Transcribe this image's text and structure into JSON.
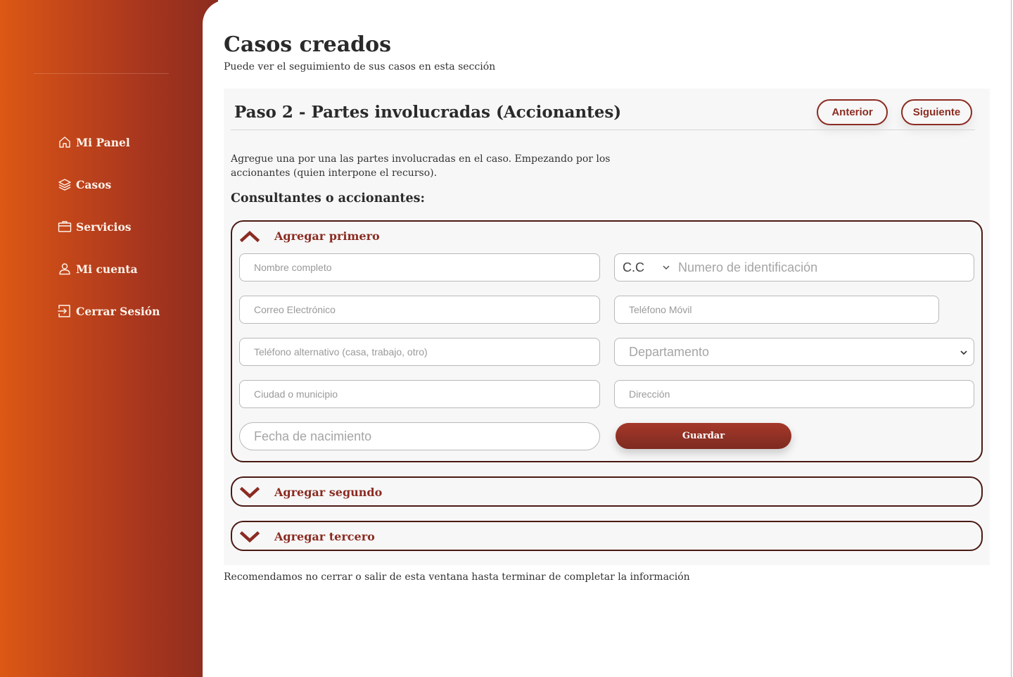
{
  "nav": [
    {
      "label": "Mi Panel",
      "icon": "home-icon"
    },
    {
      "label": "Casos",
      "icon": "layers-icon"
    },
    {
      "label": "Servicios",
      "icon": "briefcase-icon"
    },
    {
      "label": "Mi cuenta",
      "icon": "user-icon"
    },
    {
      "label": "Cerrar Sesión",
      "icon": "logout-icon"
    }
  ],
  "page": {
    "title": "Casos creados",
    "subtitle": "Puede ver el seguimiento de sus casos en esta sección"
  },
  "step": {
    "title": "Paso 2 - Partes involucradas (Accionantes)",
    "prev_label": "Anterior",
    "next_label": "Siguiente",
    "intro": "Agregue una por una las partes involucradas en el caso. Empezando por los accionantes (quien interpone el recurso).",
    "section_label": "Consultantes o accionantes:"
  },
  "accordions": [
    {
      "label": "Agregar primero",
      "expanded": true
    },
    {
      "label": "Agregar segundo",
      "expanded": false
    },
    {
      "label": "Agregar tercero",
      "expanded": false
    }
  ],
  "form": {
    "full_name_placeholder": "Nombre completo",
    "id_type_value": "C.C",
    "id_number_placeholder": "Numero de identificación",
    "email_placeholder": "Correo Electrónico",
    "mobile_placeholder": "Teléfono Móvil",
    "alt_phone_placeholder": "Teléfono alternativo (casa, trabajo, otro)",
    "department_value": "Departamento",
    "city_placeholder": "Ciudad o municipio",
    "address_placeholder": "Dirección",
    "birthdate_placeholder": "Fecha de nacimiento",
    "save_label": "Guardar"
  },
  "footer_note": "Recomendamos no cerrar o salir de esta ventana hasta terminar de completar la información",
  "colors": {
    "sidebar_start": "#dc5814",
    "sidebar_end": "#8b2c1f",
    "accent": "#8b2c22",
    "card_bg": "#f7f7f7"
  }
}
